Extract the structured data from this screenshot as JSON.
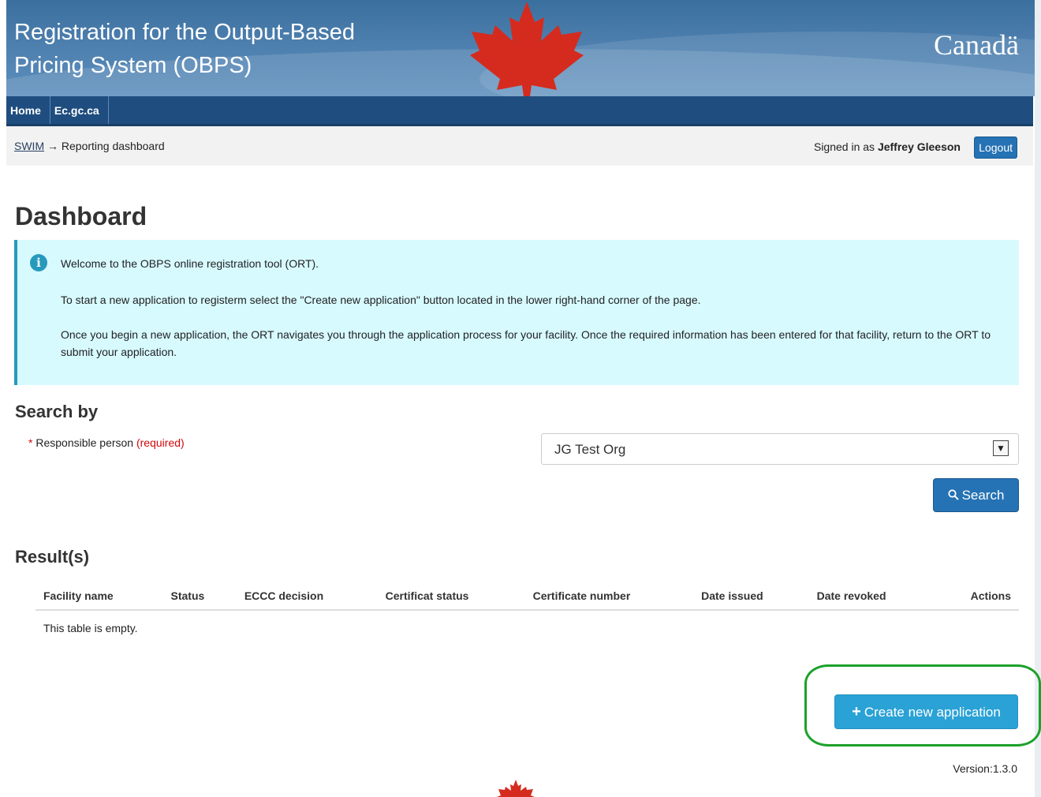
{
  "header": {
    "title_line1": "Registration for the Output-Based",
    "title_line2": "Pricing System (OBPS)",
    "wordmark": "Canadä",
    "leaf_color": "#d52b1e"
  },
  "nav": {
    "items": [
      {
        "label": "Home"
      },
      {
        "label": "Ec.gc.ca"
      }
    ]
  },
  "breadcrumb": {
    "root": "SWIM",
    "arrow": "→",
    "current": "Reporting dashboard"
  },
  "user": {
    "signed_in_prefix": "Signed in as",
    "name": "Jeffrey Gleeson",
    "logout_label": "Logout"
  },
  "page_title": "Dashboard",
  "alert": {
    "icon": "info-icon",
    "p1": "Welcome to the OBPS online registration tool (ORT).",
    "p2": "To start a new application to registerm select the \"Create new application\" button located in the lower right-hand corner of the page.",
    "p3": "Once you begin a new application, the ORT navigates you through the application process for your facility. Once the required information has been entered for that facility, return to the ORT to submit your application."
  },
  "search": {
    "heading": "Search by",
    "field_star": "*",
    "field_label": "Responsible person",
    "field_required": "(required)",
    "selected_value": "JG Test Org",
    "button_label": "Search"
  },
  "results": {
    "heading": "Result(s)",
    "columns": [
      "Facility name",
      "Status",
      "ECCC decision",
      "Certificat status",
      "Certificate number",
      "Date issued",
      "Date revoked",
      "Actions"
    ],
    "empty_text": "This table is empty."
  },
  "actions": {
    "create_label": "Create new application"
  },
  "footer": {
    "version": "Version:1.3.0"
  }
}
